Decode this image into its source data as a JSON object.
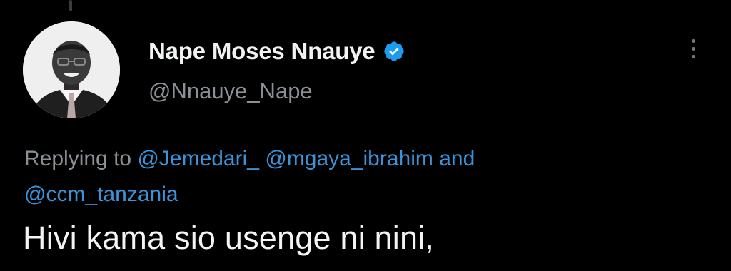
{
  "tweet": {
    "author": {
      "display_name": "Nape Moses Nnauye",
      "handle": "@Nnauye_Nape",
      "verified": true,
      "avatar_icon": "profile-photo-man-in-suit"
    },
    "reply_context": {
      "prefix": "Replying to",
      "mentions": [
        "@Jemedari_",
        "@mgaya_ibrahim"
      ],
      "conjunction": "and",
      "last_mention": "@ccm_tanzania"
    },
    "text": "Hivi kama sio usenge ni nini,",
    "more_icon": "more-vertical-icon"
  },
  "colors": {
    "background": "#000000",
    "link": "#3b92d6",
    "verified": "#1d9bf0",
    "secondary_text": "#8b9096"
  }
}
